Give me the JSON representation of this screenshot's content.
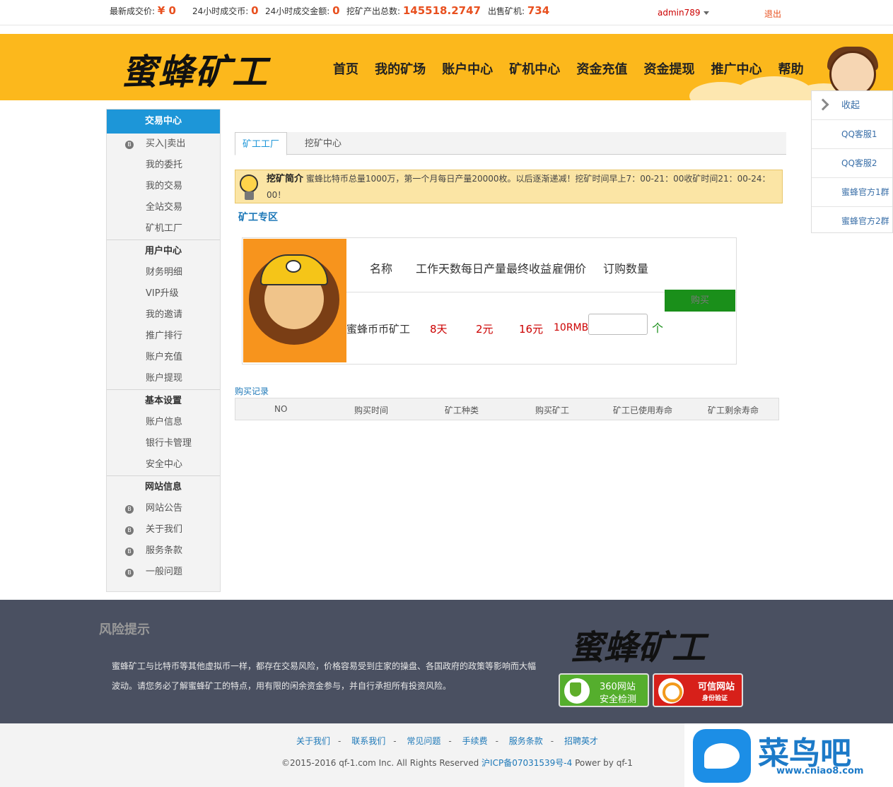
{
  "topbar": {
    "last_price_label": "最新成交价:",
    "last_price_value": "¥ 0",
    "volume_24h_label": "24小时成交币:",
    "volume_24h_value": "0",
    "amount_24h_label": "24小时成交金额:",
    "amount_24h_value": "0",
    "mined_total_label": "挖矿产出总数:",
    "mined_total_value": "145518.2747",
    "sold_miners_label": "出售矿机:",
    "sold_miners_value": "734",
    "username": "admin789",
    "logout": "退出"
  },
  "header": {
    "logo_text": "蜜蜂矿工",
    "nav": [
      "首页",
      "我的矿场",
      "账户中心",
      "矿机中心",
      "资金充值",
      "资金提现",
      "推广中心",
      "帮助"
    ]
  },
  "float_panel": {
    "collapse": "收起",
    "items": [
      "QQ客服1",
      "QQ客服2",
      "蜜蜂官方1群",
      "蜜蜂官方2群"
    ]
  },
  "sidebar": {
    "trade_header": "交易中心",
    "trade_items": [
      "买入|卖出",
      "我的委托",
      "我的交易",
      "全站交易",
      "矿机工厂"
    ],
    "user_header": "用户中心",
    "user_items": [
      "财务明细",
      "VIP升级",
      "我的邀请",
      "推广排行",
      "账户充值",
      "账户提现"
    ],
    "settings_header": "基本设置",
    "settings_items": [
      "账户信息",
      "银行卡管理",
      "安全中心"
    ],
    "site_header": "网站信息",
    "site_items": [
      "网站公告",
      "关于我们",
      "服务条款",
      "一般问题"
    ]
  },
  "main": {
    "tabs": [
      "矿工工厂",
      "挖矿中心"
    ],
    "notice_title": "挖矿简介",
    "notice_text": "蜜蜂比特币总量1000万，第一个月每日产量20000枚。以后逐渐递减！挖矿时间早上7：00-21：00收矿时间21：00-24：00！",
    "zone_title": "矿工专区",
    "product": {
      "headers": [
        "名称",
        "工作天数",
        "每日产量",
        "最终收益",
        "雇佣价",
        "订购数量"
      ],
      "name": "蜜蜂币币矿工",
      "days": "8天",
      "daily": "2元",
      "total": "16元",
      "price": "10RMB",
      "qty_placeholder": "",
      "unit": "个",
      "buy_label": "购买"
    },
    "record_title": "购买记录",
    "record_headers": [
      "NO",
      "购买时间",
      "矿工种类",
      "购买矿工",
      "矿工已使用寿命",
      "矿工剩余寿命"
    ]
  },
  "footer": {
    "risk_title": "风险提示",
    "risk_text": "蜜蜂矿工与比特币等其他虚拟币一样，都存在交易风险，价格容易受到庄家的操盘、各国政府的政策等影响而大幅波动。请您务必了解蜜蜂矿工的特点，用有限的闲余资金参与，并自行承担所有投资风险。",
    "logo_text": "蜜蜂矿工",
    "badge1_line1": "360网站",
    "badge1_line2": "安全检测",
    "badge2_line1": "可信网站",
    "badge2_line2": "身份验证"
  },
  "subfooter": {
    "links": [
      "关于我们",
      "联系我们",
      "常见问题",
      "手续费",
      "服务条款",
      "招聘英才"
    ],
    "copyright": "©2015-2016 qf-1.com Inc. All Rights Reserved",
    "icp": "沪ICP备07031539号-4",
    "power": "Power by qf-1"
  },
  "watermark": {
    "text": "菜鸟吧",
    "url": "www.cniao8.com"
  },
  "colors": {
    "brand_yellow": "#fcb81c",
    "accent_blue": "#1d96d8",
    "buy_green": "#1a8f1a",
    "stat_orange": "#e8501f",
    "footer_bg": "#4a5061"
  }
}
